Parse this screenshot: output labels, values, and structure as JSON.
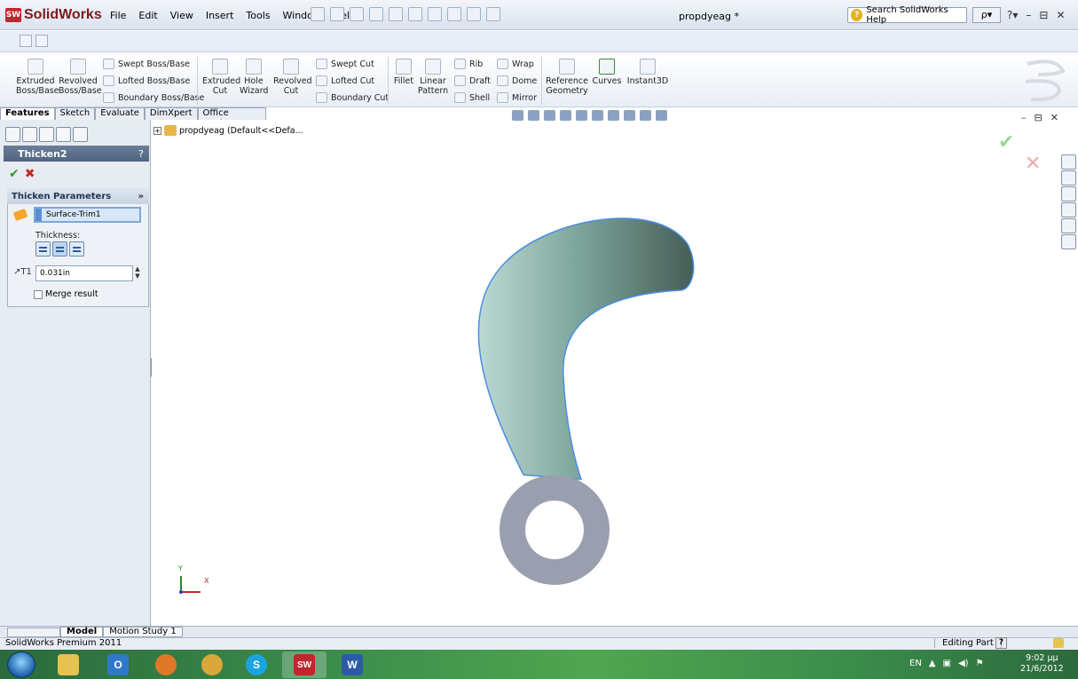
{
  "app": {
    "brand": "SolidWorks",
    "doc_title": "propdyeag *"
  },
  "menu": [
    "File",
    "Edit",
    "View",
    "Insert",
    "Tools",
    "Window",
    "Help"
  ],
  "search": {
    "text": "Search SolidWorks Help",
    "button": "ρ▾"
  },
  "window_controls": [
    "?▾",
    "–",
    "⊟",
    "✕"
  ],
  "commands": {
    "extruded_boss": "Extruded Boss/Base",
    "revolved_boss": "Revolved Boss/Base",
    "swept_boss": "Swept Boss/Base",
    "lofted_boss": "Lofted Boss/Base",
    "boundary_boss": "Boundary Boss/Base",
    "extruded_cut": "Extruded Cut",
    "hole_wizard": "Hole Wizard",
    "revolved_cut": "Revolved Cut",
    "swept_cut": "Swept Cut",
    "lofted_cut": "Lofted Cut",
    "boundary_cut": "Boundary Cut",
    "fillet": "Fillet",
    "linear_pattern": "Linear Pattern",
    "rib": "Rib",
    "draft": "Draft",
    "shell": "Shell",
    "wrap": "Wrap",
    "dome": "Dome",
    "mirror": "Mirror",
    "reference_geometry": "Reference Geometry",
    "curves": "Curves",
    "instant3d": "Instant3D"
  },
  "tabs": [
    "Features",
    "Sketch",
    "Evaluate",
    "DimXpert",
    "Office Products"
  ],
  "property_manager": {
    "title": "Thicken2",
    "help": "?",
    "group_title": "Thicken Parameters",
    "surface": "Surface-Trim1",
    "thickness_label": "Thickness:",
    "thickness_value": "0.031in",
    "merge_label": "Merge result"
  },
  "tree": {
    "root": "propdyeag  (Default<<Defa..."
  },
  "viewport_controls": [
    "–",
    "⊟",
    "✕"
  ],
  "axes": {
    "x": "X",
    "y": "Y"
  },
  "model_tabs": [
    "Model",
    "Motion Study 1"
  ],
  "status": {
    "left": "SolidWorks Premium 2011",
    "right": "Editing Part"
  },
  "taskbar": {
    "lang": "EN",
    "time": "9:02 μμ",
    "date": "21/6/2012"
  },
  "colors": {
    "part_surface": "#6f9a8c",
    "hub": "#9a9fb0",
    "selection_edge": "#4a8ee6"
  }
}
